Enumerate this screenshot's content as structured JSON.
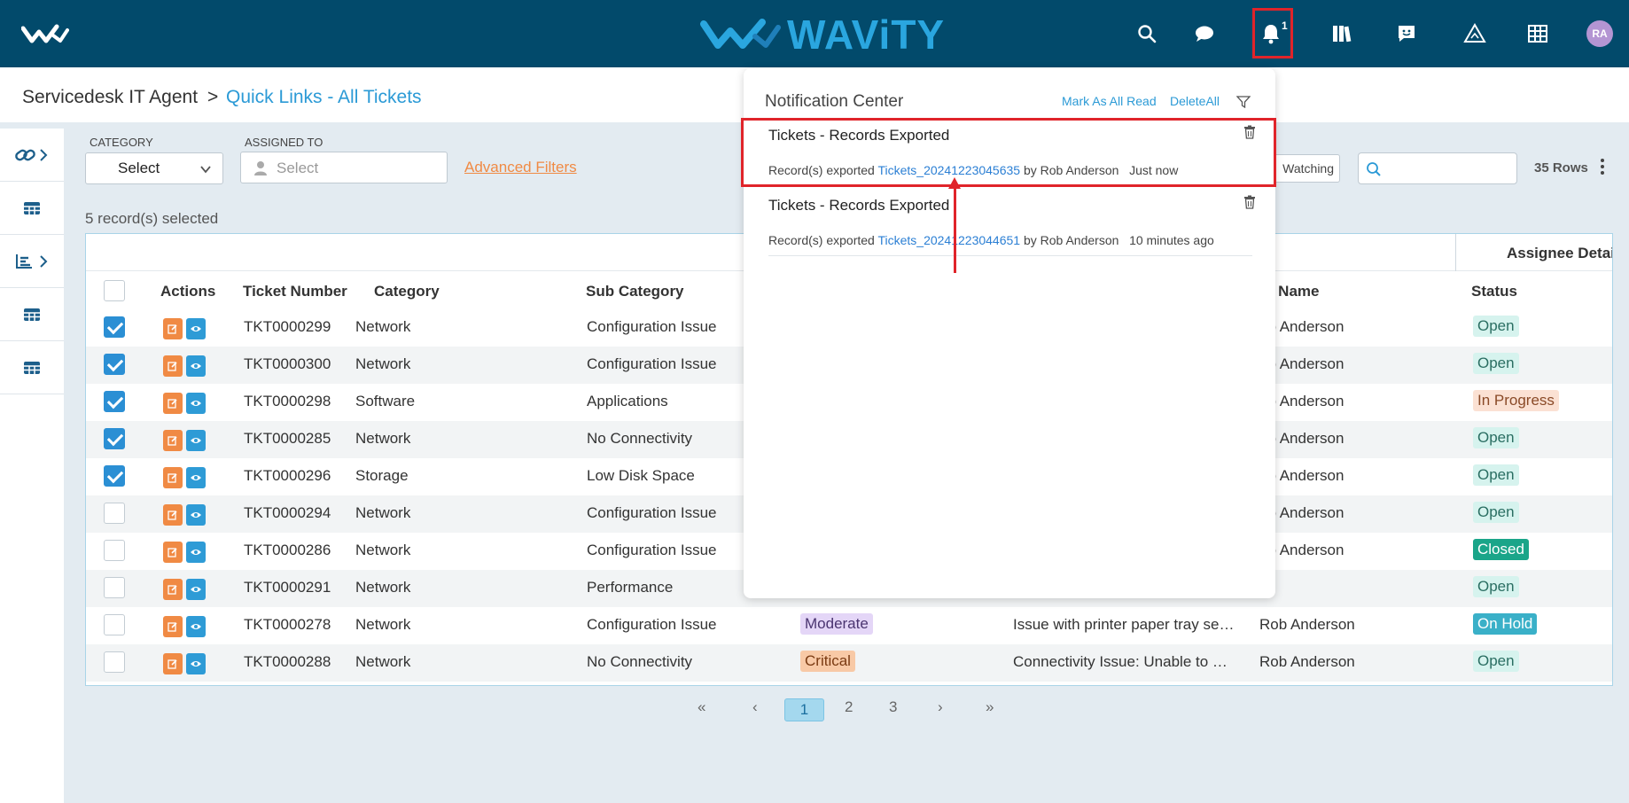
{
  "brand": {
    "name": "WAViTY"
  },
  "topbar": {
    "icons": [
      "search-icon",
      "chat-icon",
      "bell-icon",
      "library-icon",
      "feedback-icon",
      "alert-triangle-icon",
      "grid-icon"
    ],
    "notification_count": "1",
    "avatar_initials": "RA",
    "highlight_color": "#e0242a"
  },
  "breadcrumb": {
    "root": "Servicedesk IT Agent",
    "separator": ">",
    "current": "Quick Links - All Tickets"
  },
  "filters": {
    "category_label": "CATEGORY",
    "category_value": "Select",
    "assigned_label": "ASSIGNED TO",
    "assigned_placeholder": "Select",
    "advanced_filters": "Advanced Filters",
    "watching": "Watching",
    "rows": "35 Rows"
  },
  "selection_text": "5 record(s) selected",
  "table": {
    "group_header": "Assignee Details",
    "headers": {
      "actions": "Actions",
      "ticket_number": "Ticket Number",
      "category": "Category",
      "sub_category": "Sub Category",
      "full_name": "ll Name",
      "status": "Status"
    },
    "rows": [
      {
        "checked": true,
        "ticket": "TKT0000299",
        "category": "Network",
        "sub": "Configuration Issue",
        "priority": "",
        "desc": "",
        "name": "ob Anderson",
        "status": "Open"
      },
      {
        "checked": true,
        "ticket": "TKT0000300",
        "category": "Network",
        "sub": "Configuration Issue",
        "priority": "",
        "desc": "",
        "name": "ob Anderson",
        "status": "Open"
      },
      {
        "checked": true,
        "ticket": "TKT0000298",
        "category": "Software",
        "sub": "Applications",
        "priority": "",
        "desc": "",
        "name": "ob Anderson",
        "status": "In Progress"
      },
      {
        "checked": true,
        "ticket": "TKT0000285",
        "category": "Network",
        "sub": "No Connectivity",
        "priority": "",
        "desc": "",
        "name": "ob Anderson",
        "status": "Open"
      },
      {
        "checked": true,
        "ticket": "TKT0000296",
        "category": "Storage",
        "sub": "Low Disk Space",
        "priority": "",
        "desc": "",
        "name": "ob Anderson",
        "status": "Open"
      },
      {
        "checked": false,
        "ticket": "TKT0000294",
        "category": "Network",
        "sub": "Configuration Issue",
        "priority": "",
        "desc": "",
        "name": "ob Anderson",
        "status": "Open"
      },
      {
        "checked": false,
        "ticket": "TKT0000286",
        "category": "Network",
        "sub": "Configuration Issue",
        "priority": "",
        "desc": "",
        "name": "ob Anderson",
        "status": "Closed"
      },
      {
        "checked": false,
        "ticket": "TKT0000291",
        "category": "Network",
        "sub": "Performance",
        "priority": "",
        "desc": "",
        "name": "",
        "status": "Open"
      },
      {
        "checked": false,
        "ticket": "TKT0000278",
        "category": "Network",
        "sub": "Configuration Issue",
        "priority": "Moderate",
        "desc": "Issue with printer paper tray se…",
        "name": "Rob Anderson",
        "status": "On Hold"
      },
      {
        "checked": false,
        "ticket": "TKT0000288",
        "category": "Network",
        "sub": "No Connectivity",
        "priority": "Critical",
        "desc": "Connectivity Issue: Unable to …",
        "name": "Rob Anderson",
        "status": "Open"
      }
    ]
  },
  "status_styles": {
    "Open": {
      "bg": "#d6f3ee",
      "fg": "#2a6e62"
    },
    "In Progress": {
      "bg": "#fbe1d3",
      "fg": "#8a4a27"
    },
    "Closed": {
      "bg": "#1aa589",
      "fg": "#ffffff"
    },
    "On Hold": {
      "bg": "#3ab0c8",
      "fg": "#ffffff"
    }
  },
  "priority_styles": {
    "Moderate": {
      "bg": "#e4d6f7",
      "fg": "#4a3470"
    },
    "Critical": {
      "bg": "#f8c9a6",
      "fg": "#7a3a12"
    }
  },
  "pagination": {
    "first": "«",
    "prev": "‹",
    "pages": [
      "1",
      "2",
      "3"
    ],
    "next": "›",
    "last": "»"
  },
  "notifications": {
    "title": "Notification Center",
    "mark_all_read": "Mark As All Read",
    "delete_all": "DeleteAll",
    "items": [
      {
        "title": "Tickets - Records Exported",
        "prefix": "Record(s)  exported",
        "link": "Tickets_20241223045635",
        "by": "by  Rob Anderson",
        "time": "Just now"
      },
      {
        "title": "Tickets - Records Exported",
        "prefix": "Record(s)  exported",
        "link": "Tickets_20241223044651",
        "by": "by  Rob Anderson",
        "time": "10 minutes ago"
      }
    ]
  }
}
